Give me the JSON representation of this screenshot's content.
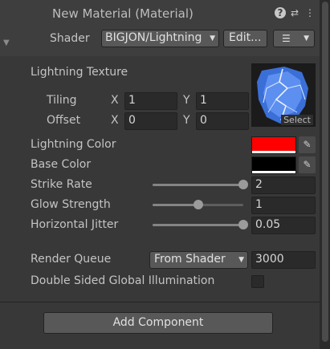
{
  "header": {
    "title": "New Material (Material)",
    "help_icon": "?",
    "presets_icon": "sliders-icon",
    "menu_icon": "kebab-menu-icon"
  },
  "shader": {
    "label": "Shader",
    "value": "BIGJON/Lightning",
    "edit_label": "Edit...",
    "list_icon": "list-icon"
  },
  "texture": {
    "label": "Lightning Texture",
    "select_label": "Select",
    "tiling_label": "Tiling",
    "offset_label": "Offset",
    "x_label": "X",
    "y_label": "Y",
    "tiling_x": "1",
    "tiling_y": "1",
    "offset_x": "0",
    "offset_y": "0"
  },
  "colors": {
    "lightning_label": "Lightning Color",
    "lightning_hex": "#ff0000",
    "base_label": "Base Color",
    "base_hex": "#000000"
  },
  "sliders": [
    {
      "label": "Strike Rate",
      "value": "2",
      "fraction": 1.0
    },
    {
      "label": "Glow Strength",
      "value": "1",
      "fraction": 0.5
    },
    {
      "label": "Horizontal Jitter",
      "value": "0.05",
      "fraction": 1.0
    }
  ],
  "render_queue": {
    "label": "Render Queue",
    "mode": "From Shader",
    "value": "3000"
  },
  "gi": {
    "label": "Double Sided Global Illumination",
    "checked": false
  },
  "footer": {
    "add_component_label": "Add Component"
  }
}
